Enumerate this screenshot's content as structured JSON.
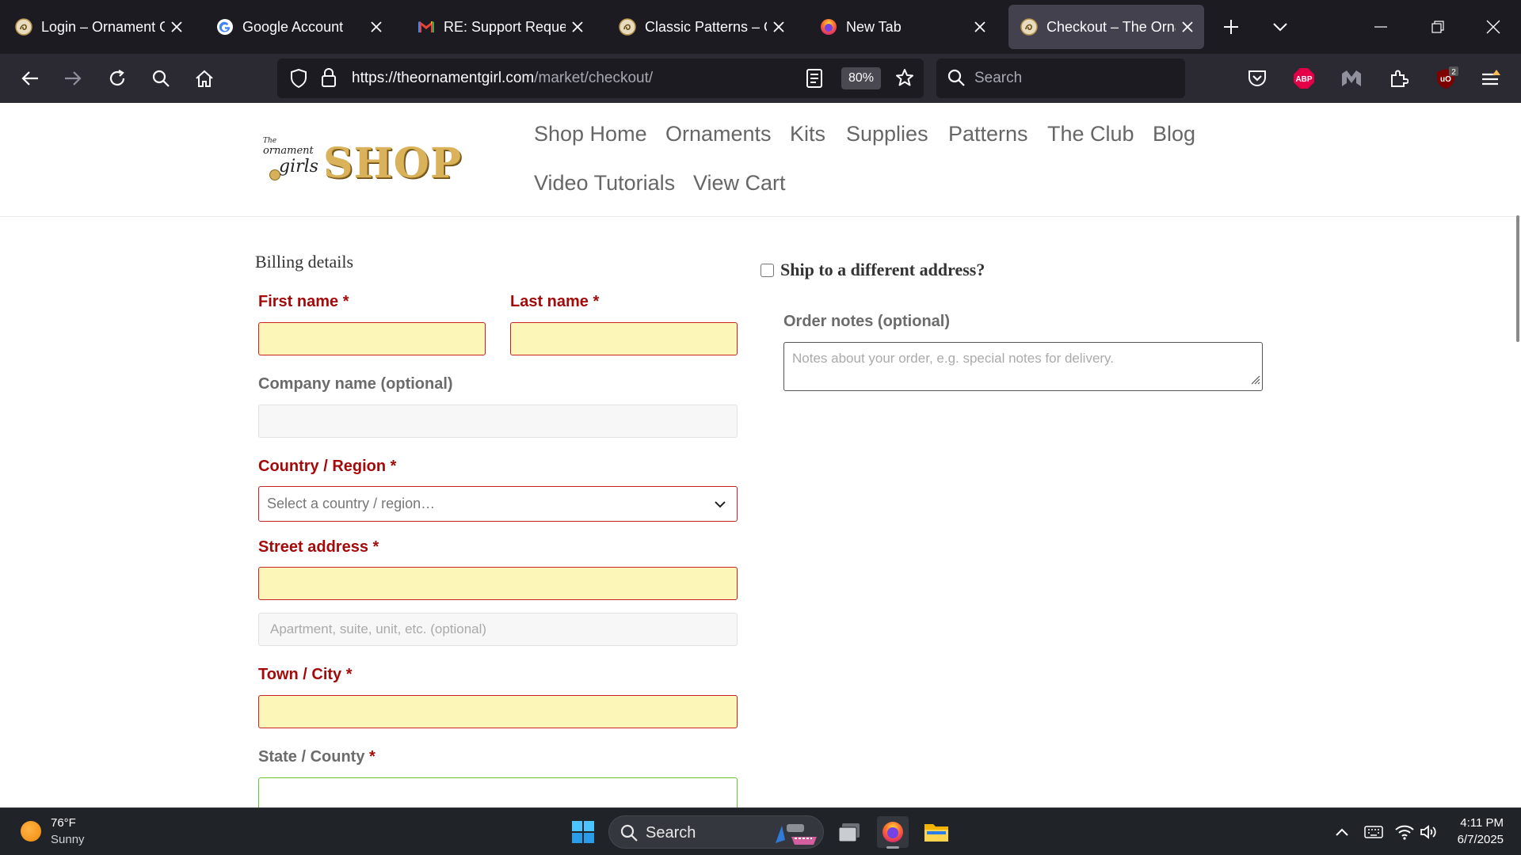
{
  "browser": {
    "tabs": [
      {
        "title": "Login – Ornament Girl",
        "icon": "ornament-girl-favicon"
      },
      {
        "title": "Google Account",
        "icon": "google-favicon"
      },
      {
        "title": "RE: Support Request -",
        "icon": "gmail-favicon"
      },
      {
        "title": "Classic Patterns – Orna",
        "icon": "ornament-girl-favicon"
      },
      {
        "title": "New Tab",
        "icon": "firefox-favicon"
      },
      {
        "title": "Checkout – The Ornam",
        "icon": "ornament-girl-favicon",
        "active": true
      }
    ],
    "url_host": "https://theornamentgirl.com",
    "url_path": "/market/checkout/",
    "zoom": "80%",
    "search_placeholder": "Search",
    "extension_badge": "2",
    "abp_label": "ABP"
  },
  "site": {
    "logo": {
      "small_top": "The",
      "small_mid": "ornament",
      "small_script": "girls",
      "shop": "SHOP"
    },
    "nav": [
      "Shop Home",
      "Ornaments",
      "Kits",
      "Supplies",
      "Patterns",
      "The Club",
      "Blog",
      "Video Tutorials",
      "View Cart"
    ]
  },
  "checkout": {
    "billing_title": "Billing details",
    "first_name_label": "First name",
    "last_name_label": "Last name",
    "company_label": "Company name (optional)",
    "country_label": "Country / Region",
    "country_placeholder": "Select a country / region…",
    "street_label": "Street address",
    "apartment_placeholder": "Apartment, suite, unit, etc. (optional)",
    "city_label": "Town / City",
    "state_label": "State / County",
    "required_mark": "*",
    "ship_different_label": "Ship to a different address?",
    "order_notes_label": "Order notes (optional)",
    "order_notes_placeholder": "Notes about your order, e.g. special notes for delivery."
  },
  "taskbar": {
    "temperature": "76°F",
    "condition": "Sunny",
    "search_label": "Search",
    "time": "4:11 PM",
    "date": "6/7/2025"
  },
  "colors": {
    "required_red": "#a50a0a",
    "error_field_bg": "#fdf6b9",
    "valid_border": "#6dc22e",
    "logo_gold": "#d9b25a"
  }
}
